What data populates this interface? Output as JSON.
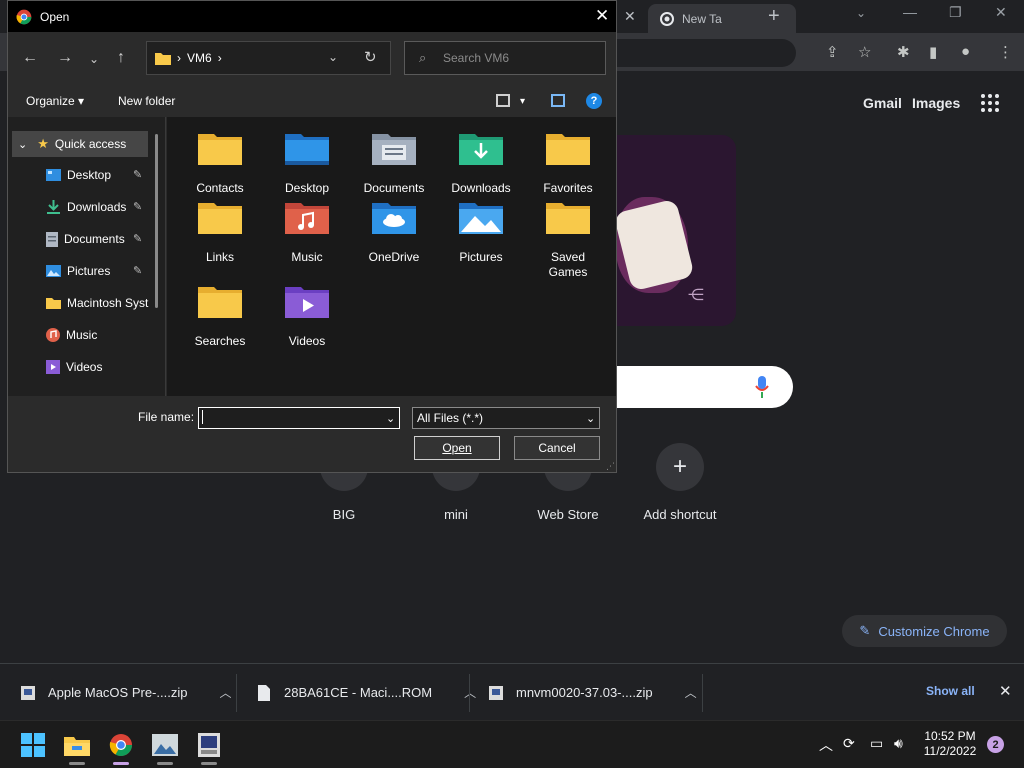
{
  "browser": {
    "tab_title": "New Ta",
    "gmail": "Gmail",
    "images": "Images",
    "shortcuts": [
      "BIG",
      "mini",
      "Web Store"
    ],
    "add_shortcut": "Add shortcut",
    "customize": "Customize Chrome"
  },
  "dialog": {
    "title": "Open",
    "path": "VM6",
    "search_placeholder": "Search VM6",
    "organize": "Organize",
    "new_folder": "New folder",
    "help": "?",
    "nav": {
      "quick_access": "Quick access",
      "items": [
        {
          "label": "Desktop",
          "icon": "desktop-icon",
          "pinned": true
        },
        {
          "label": "Downloads",
          "icon": "download-icon",
          "pinned": true
        },
        {
          "label": "Documents",
          "icon": "document-icon",
          "pinned": true
        },
        {
          "label": "Pictures",
          "icon": "picture-icon",
          "pinned": true
        },
        {
          "label": "Macintosh Syst",
          "icon": "folder-icon",
          "pinned": false
        },
        {
          "label": "Music",
          "icon": "music-icon",
          "pinned": false
        },
        {
          "label": "Videos",
          "icon": "video-icon",
          "pinned": false
        }
      ]
    },
    "folders": [
      {
        "label": "Contacts",
        "kind": "plain"
      },
      {
        "label": "Desktop",
        "kind": "desktop"
      },
      {
        "label": "Documents",
        "kind": "documents"
      },
      {
        "label": "Downloads",
        "kind": "downloads"
      },
      {
        "label": "Favorites",
        "kind": "plain"
      },
      {
        "label": "Links",
        "kind": "plain"
      },
      {
        "label": "Music",
        "kind": "music"
      },
      {
        "label": "OneDrive",
        "kind": "onedrive"
      },
      {
        "label": "Pictures",
        "kind": "pictures"
      },
      {
        "label": "Saved Games",
        "kind": "plain"
      },
      {
        "label": "Searches",
        "kind": "plain"
      },
      {
        "label": "Videos",
        "kind": "videos"
      }
    ],
    "file_name_label": "File name:",
    "file_name_value": "",
    "filter": "All Files (*.*)",
    "open_button": "Open",
    "cancel_button": "Cancel"
  },
  "downloads": {
    "items": [
      "Apple MacOS Pre-....zip",
      "28BA61CE - Maci....ROM",
      "mnvm0020-37.03-....zip"
    ],
    "show_all": "Show all"
  },
  "taskbar": {
    "time": "10:52 PM",
    "date": "11/2/2022",
    "notifications": "2"
  },
  "colors": {
    "accent": "#8ab4f8",
    "folder_yellow": "#f8c94a",
    "dialog_bg": "#2b2b2b"
  }
}
